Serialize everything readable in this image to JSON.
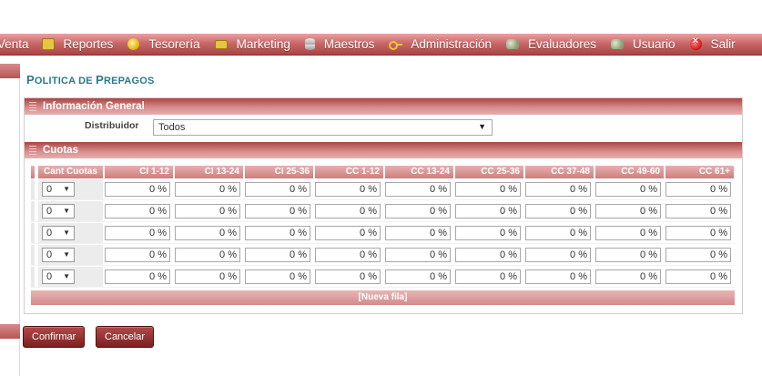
{
  "menu": [
    {
      "label": "Venta",
      "icon": "none"
    },
    {
      "label": "Reportes",
      "icon": "folder-icon"
    },
    {
      "label": "Tesorería",
      "icon": "coin-icon"
    },
    {
      "label": "Marketing",
      "icon": "monitor-icon"
    },
    {
      "label": "Maestros",
      "icon": "database-icon"
    },
    {
      "label": "Administración",
      "icon": "key-icon"
    },
    {
      "label": "Evaluadores",
      "icon": "users-icon"
    },
    {
      "label": "Usuario",
      "icon": "users-icon"
    },
    {
      "label": "Salir",
      "icon": "stop-icon"
    }
  ],
  "page": {
    "title_first": "P",
    "title_rest": "OLITICA DE ",
    "title_first2": "P",
    "title_rest2": "REPAGOS"
  },
  "sections": {
    "general": "Información General",
    "cuotas": "Cuotas"
  },
  "distribuidor": {
    "label": "Distribuidor",
    "value": "Todos",
    "arrow": "▼"
  },
  "grid": {
    "columns": [
      "Cant Cuotas",
      "CI 1-12",
      "CI 13-24",
      "CI 25-36",
      "CC 1-12",
      "CC 13-24",
      "CC 25-36",
      "CC 37-48",
      "CC 49-60",
      "CC 61+"
    ],
    "rows": [
      {
        "cant": "0",
        "values": [
          "0 %",
          "0 %",
          "0 %",
          "0 %",
          "0 %",
          "0 %",
          "0 %",
          "0 %",
          "0 %"
        ]
      },
      {
        "cant": "0",
        "values": [
          "0 %",
          "0 %",
          "0 %",
          "0 %",
          "0 %",
          "0 %",
          "0 %",
          "0 %",
          "0 %"
        ]
      },
      {
        "cant": "0",
        "values": [
          "0 %",
          "0 %",
          "0 %",
          "0 %",
          "0 %",
          "0 %",
          "0 %",
          "0 %",
          "0 %"
        ]
      },
      {
        "cant": "0",
        "values": [
          "0 %",
          "0 %",
          "0 %",
          "0 %",
          "0 %",
          "0 %",
          "0 %",
          "0 %",
          "0 %"
        ]
      },
      {
        "cant": "0",
        "values": [
          "0 %",
          "0 %",
          "0 %",
          "0 %",
          "0 %",
          "0 %",
          "0 %",
          "0 %",
          "0 %"
        ]
      }
    ],
    "new_row": "[Nueva fila]"
  },
  "buttons": {
    "confirm": "Confirmar",
    "cancel": "Cancelar"
  },
  "colors": {
    "accent": "#a94444",
    "title": "#2a7a86"
  }
}
